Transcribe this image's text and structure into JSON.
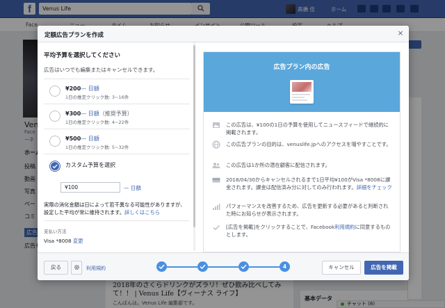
{
  "facebook": {
    "search_value": "Venus Life",
    "user_name": "高橋 佳",
    "home_label": "ホーム",
    "nav_tabs": [
      "Face",
      "ニュー",
      "タイム",
      "お知らせ",
      "インサイト",
      "公開ツール",
      "設定",
      "ヘルプ"
    ],
    "sidebar_items": [
      "Venu",
      "Face",
      "ーネ",
      "ホーム",
      "投稿",
      "動画",
      "写真",
      "ペー",
      "コミ",
      "広告",
      "広告セ"
    ],
    "post_title": "2018年のさくらドリンクがズラリ！ぜひ飲み比べしてみて！！ | Venus Life【ヴィーナス ライフ】",
    "post_sub": "こんばんは。Venus Life 編集部です。",
    "basic_data_title": "基本データ",
    "chat_label": "チャット (8)"
  },
  "modal": {
    "title": "定額広告プランを作成",
    "close_symbol": "×",
    "left": {
      "section_title": "平均予算を選択してください",
      "section_desc": "広告はいつでも編集またはキャンセルできます。",
      "options": [
        {
          "price": "¥200",
          "period": "— 日額",
          "tag": "",
          "sub": "1日の推定クリック数: 3~16件"
        },
        {
          "price": "¥300",
          "period": "— 日額",
          "tag": "（推奨予算）",
          "sub": "1日の推定クリック数: 4~22件"
        },
        {
          "price": "¥500",
          "period": "— 日額",
          "tag": "",
          "sub": "1日の推定クリック数: 5~32件"
        }
      ],
      "custom_label": "カスタム予算を選択",
      "custom_value": "¥100",
      "custom_unit": "— 日額",
      "note": "実際の消化金額は日によって若干異なる可能性がありますが、設定した平均が常に維持されます。",
      "note_link": "詳しくはこちら",
      "payment_label": "支払い方法",
      "payment_value": "Visa *8008",
      "payment_change": "変更"
    },
    "right": {
      "preview_title": "広告プラン内の広告",
      "items": [
        {
          "icon": "image-icon",
          "text": "この広告は、¥100の1日の予算を使用してニュースフィードで継続的に掲載されます。",
          "link": "",
          "tail": ""
        },
        {
          "icon": "globe-icon",
          "text": "この広告プランの目的は、venuslife.jpへのアクセスを増やすことです。",
          "link": "",
          "tail": ""
        },
        {
          "icon": "people-icon",
          "text": "この広告は1か所の潜在顧客に配信されます。",
          "link": "",
          "tail": ""
        },
        {
          "icon": "credit-card-icon",
          "text": "2018/04/30からキャンセルされるまで1日平均¥100がVisa *8008に課金されます。課金は配信済み分に対してのみ行われます。",
          "link": "詳細をチェック",
          "tail": ""
        },
        {
          "icon": "performance-bars-icon",
          "text": "パフォーマンスを改善するため、広告を更新する必要があると判断された時にお知らせが表示されます。",
          "link": "",
          "tail": ""
        },
        {
          "icon": "check-icon",
          "text": "[広告を掲載]をクリックすることで、Facebook",
          "link": "利用規約",
          "tail": "に同意するものとします。"
        }
      ]
    },
    "footer": {
      "back_label": "戻る",
      "terms_label": "利用規約",
      "step_final": "4",
      "cancel_label": "キャンセル",
      "submit_label": "広告を掲載"
    }
  }
}
